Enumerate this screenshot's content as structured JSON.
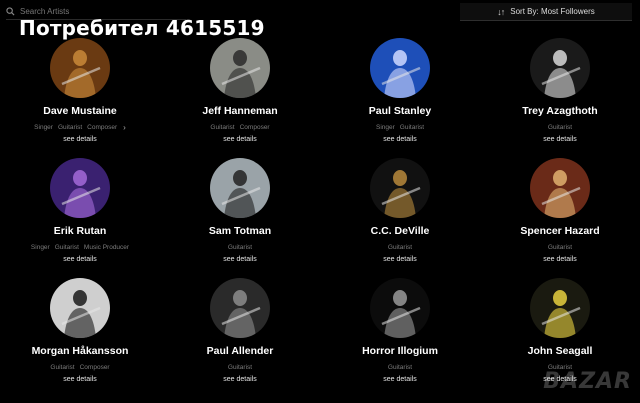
{
  "search": {
    "placeholder": "Search Artists",
    "icon": "search-icon"
  },
  "overlay_title": "Потребител 4615519",
  "sort": {
    "icon": "sort-arrows-icon",
    "label": "Sort By: Most Followers"
  },
  "artists": [
    {
      "name": "Dave Mustaine",
      "tags": [
        "Singer",
        "Guitarist",
        "Composer"
      ],
      "has_more": true,
      "link": "see details",
      "bg": "#6a3a12",
      "fg": "#c98a3a"
    },
    {
      "name": "Jeff Hanneman",
      "tags": [
        "Guitarist",
        "Composer"
      ],
      "has_more": false,
      "link": "see details",
      "bg": "#8a8c86",
      "fg": "#2a2a2a"
    },
    {
      "name": "Paul Stanley",
      "tags": [
        "Singer",
        "Guitarist"
      ],
      "has_more": false,
      "link": "see details",
      "bg": "#1e4fb8",
      "fg": "#cfd8ff"
    },
    {
      "name": "Trey Azagthoth",
      "tags": [
        "Guitarist"
      ],
      "has_more": false,
      "link": "see details",
      "bg": "#1a1a1a",
      "fg": "#d8d8d8"
    },
    {
      "name": "Erik Rutan",
      "tags": [
        "Singer",
        "Guitarist",
        "Music Producer"
      ],
      "has_more": false,
      "link": "see details",
      "bg": "#3a2170",
      "fg": "#a56ad8"
    },
    {
      "name": "Sam Totman",
      "tags": [
        "Guitarist"
      ],
      "has_more": false,
      "link": "see details",
      "bg": "#9aa3a8",
      "fg": "#222"
    },
    {
      "name": "C.C. DeVille",
      "tags": [
        "Guitarist"
      ],
      "has_more": false,
      "link": "see details",
      "bg": "#111",
      "fg": "#b88a3c"
    },
    {
      "name": "Spencer Hazard",
      "tags": [
        "Guitarist"
      ],
      "has_more": false,
      "link": "see details",
      "bg": "#6a2a18",
      "fg": "#e0b070"
    },
    {
      "name": "Morgan Håkansson",
      "tags": [
        "Guitarist",
        "Composer"
      ],
      "has_more": false,
      "link": "see details",
      "bg": "#cfcfcf",
      "fg": "#1a1a1a"
    },
    {
      "name": "Paul Allender",
      "tags": [
        "Guitarist"
      ],
      "has_more": false,
      "link": "see details",
      "bg": "#2a2a2a",
      "fg": "#8c8c8c"
    },
    {
      "name": "Horror Illogium",
      "tags": [
        "Guitarist"
      ],
      "has_more": false,
      "link": "see details",
      "bg": "#0c0c0c",
      "fg": "#9a9a9a"
    },
    {
      "name": "John Seagall",
      "tags": [
        "Guitarist"
      ],
      "has_more": false,
      "link": "see details",
      "bg": "#1a1a10",
      "fg": "#e8d040"
    }
  ],
  "watermark": "BAZAR"
}
